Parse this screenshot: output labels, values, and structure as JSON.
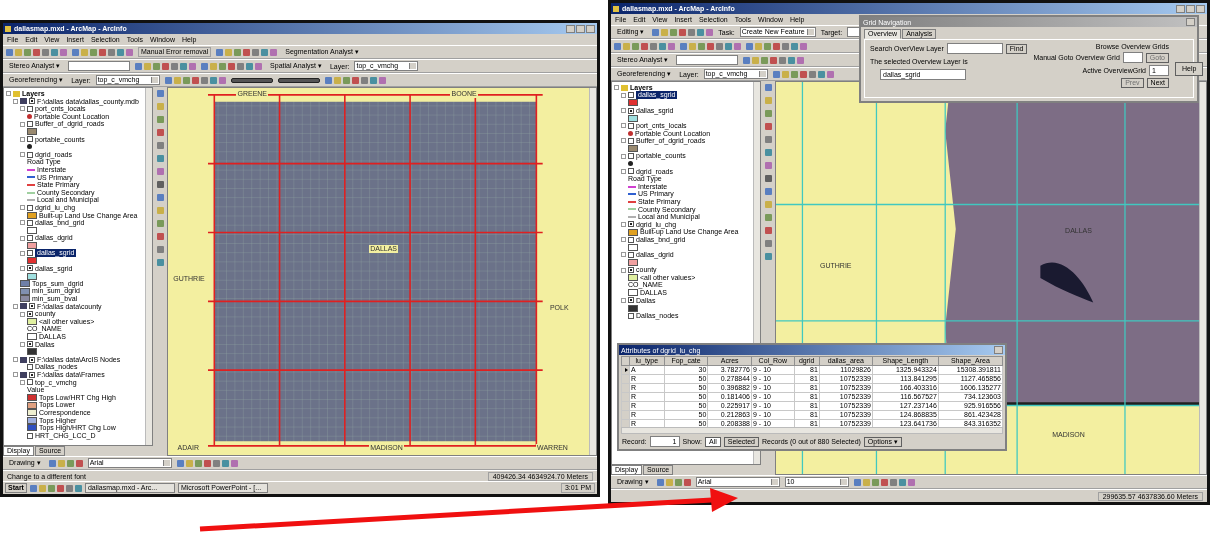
{
  "windows": [
    {
      "title": "dallasmap.mxd - ArcMap - ArcInfo",
      "menu": [
        "File",
        "Edit",
        "View",
        "Insert",
        "Selection",
        "Tools",
        "Window",
        "Help"
      ],
      "toolbars": [
        [
          {
            "kind": "icons"
          },
          {
            "kind": "icons"
          },
          {
            "kind": "button",
            "text": "Manual Error removal"
          },
          {
            "kind": "icons"
          },
          {
            "kind": "dropdown",
            "text": "Segmentation Analyst ▾"
          }
        ],
        [
          {
            "kind": "dropdown",
            "text": "Stereo Analyst ▾"
          },
          {
            "kind": "field"
          },
          {
            "kind": "icons"
          },
          {
            "kind": "icons"
          },
          {
            "kind": "dropdown",
            "text": "Spatial Analyst ▾"
          },
          {
            "kind": "label",
            "text": "Layer:"
          },
          {
            "kind": "combo",
            "text": "top_c_vmchg"
          }
        ],
        [
          {
            "kind": "dropdown",
            "text": "Georeferencing ▾"
          },
          {
            "kind": "label",
            "text": "Layer:"
          },
          {
            "kind": "combo",
            "text": "top_c_vmchg"
          },
          {
            "kind": "icons"
          },
          {
            "kind": "track"
          },
          {
            "kind": "track"
          },
          {
            "kind": "icons"
          }
        ]
      ],
      "toc": {
        "kind": "root",
        "label": "Layers",
        "children": [
          {
            "kind": "group",
            "label": "F:\\dallas data\\dallas_county.mdb",
            "checked": true,
            "selected": false,
            "children": [
              {
                "kind": "layer",
                "label": "port_cnts_locals",
                "checked": false,
                "selected": false,
                "children": [
                  {
                    "kind": "point",
                    "label": "Portable Count Location",
                    "color": "#c03030"
                  }
                ]
              },
              {
                "kind": "layer",
                "label": "Buffer_of_dgrid_roads",
                "checked": false,
                "selected": false,
                "children": [
                  {
                    "kind": "legend",
                    "color": "#9a8a70"
                  }
                ]
              },
              {
                "kind": "layer",
                "label": "portable_counts",
                "checked": false,
                "selected": false,
                "children": [
                  {
                    "kind": "point",
                    "color": "#222222"
                  }
                ]
              },
              {
                "kind": "layer",
                "label": "dgrid_roads",
                "checked": false,
                "selected": false,
                "children": [
                  {
                    "kind": "text",
                    "label": "Road Type"
                  },
                  {
                    "kind": "line",
                    "label": "Interstate",
                    "color": "#d040d0"
                  },
                  {
                    "kind": "line",
                    "label": "US Primary",
                    "color": "#3060d0"
                  },
                  {
                    "kind": "line",
                    "label": "State Primary",
                    "color": "#e04040"
                  },
                  {
                    "kind": "line",
                    "label": "County Secondary",
                    "color": "#a0d0a0"
                  },
                  {
                    "kind": "line",
                    "label": "Local and Municipal",
                    "color": "#b0b0b0"
                  }
                ]
              },
              {
                "kind": "layer",
                "label": "dgrid_lu_chg",
                "checked": false,
                "selected": false,
                "children": [
                  {
                    "kind": "legend",
                    "label": "Built-up Land Use Change Area",
                    "color": "#e0a020"
                  }
                ]
              },
              {
                "kind": "layer",
                "label": "dallas_bnd_grid",
                "checked": false,
                "selected": false,
                "children": [
                  {
                    "kind": "legend",
                    "color": "#ffffff"
                  }
                ]
              },
              {
                "kind": "layer",
                "label": "dallas_dgrid",
                "checked": false,
                "selected": false,
                "children": [
                  {
                    "kind": "legend",
                    "color": "#f0a0a0"
                  }
                ]
              },
              {
                "kind": "layer",
                "label": "dallas_sgrid",
                "checked": false,
                "selected": true,
                "children": [
                  {
                    "kind": "legend",
                    "color": "#e03030"
                  }
                ]
              },
              {
                "kind": "layer",
                "label": "dallas_sgrid",
                "checked": true,
                "selected": false,
                "children": [
                  {
                    "kind": "legend",
                    "color": "#a0e0e0"
                  }
                ]
              },
              {
                "kind": "legend",
                "label": "Tops_sum_dgrid",
                "color": "#7080a8"
              },
              {
                "kind": "legend",
                "label": "min_sum_dgrid",
                "color": "#8090b0"
              },
              {
                "kind": "legend",
                "label": "min_sum_bval",
                "color": "#8a8aa0"
              }
            ]
          },
          {
            "kind": "group",
            "label": "F:\\dallas data\\county",
            "checked": true,
            "selected": false,
            "children": [
              {
                "kind": "layer",
                "label": "county",
                "checked": true,
                "selected": false,
                "children": [
                  {
                    "kind": "legend",
                    "label": "<all other values>",
                    "color": "#e0f0a0"
                  },
                  {
                    "kind": "text",
                    "label": "CO_NAME"
                  },
                  {
                    "kind": "legend",
                    "label": "DALLAS",
                    "color": "#ffffff"
                  }
                ]
              },
              {
                "kind": "layer",
                "label": "Dallas",
                "checked": true,
                "selected": false,
                "children": [
                  {
                    "kind": "legend",
                    "color": "#333333"
                  }
                ]
              }
            ]
          },
          {
            "kind": "group",
            "label": "F:\\dallas data\\ArcIS Nodes",
            "checked": true,
            "selected": false,
            "children": [
              {
                "kind": "layer",
                "label": "Dallas_nodes",
                "checked": false,
                "selected": false
              }
            ]
          },
          {
            "kind": "group",
            "label": "F:\\dallas data\\Frames",
            "checked": true,
            "selected": false,
            "children": [
              {
                "kind": "layer",
                "label": "top_c_vmchg",
                "checked": false,
                "selected": false,
                "children": [
                  {
                    "kind": "text",
                    "label": "Value"
                  },
                  {
                    "kind": "legend",
                    "label": "Tops Low/HRT Chg High",
                    "color": "#d03030"
                  },
                  {
                    "kind": "legend",
                    "label": "Tops Lower",
                    "color": "#e0a080"
                  },
                  {
                    "kind": "legend",
                    "label": "Correspondence",
                    "color": "#f0f0d0"
                  },
                  {
                    "kind": "legend",
                    "label": "Tops Higher",
                    "color": "#a0b0e0"
                  },
                  {
                    "kind": "legend",
                    "label": "Tops High/HRT Chg Low",
                    "color": "#3050c0"
                  }
                ]
              },
              {
                "kind": "layer",
                "label": "HRT_CHG_LCC_D",
                "checked": false,
                "selected": false
              }
            ]
          }
        ]
      },
      "toc_tabs": [
        {
          "label": "Display",
          "selected": true
        },
        {
          "label": "Source",
          "selected": false
        }
      ],
      "map": {
        "kind": "grid-overview",
        "labels": [
          {
            "text": "GREENE"
          },
          {
            "text": "BOONE"
          },
          {
            "text": "GUTHRIE"
          },
          {
            "text": "DALLAS"
          },
          {
            "text": "POLK"
          },
          {
            "text": "ADAIR"
          },
          {
            "text": "MADISON"
          },
          {
            "text": "WARREN"
          }
        ]
      },
      "drawing_toolbar": {
        "label": "Drawing ▾",
        "font": "Arial"
      },
      "status": {
        "message": "Change to a different font",
        "coordinates": "409426.34  4634924.70 Meters"
      },
      "taskbar": {
        "start": "Start",
        "tasks": [
          "dallasmap.mxd - Arc...",
          "Microsoft PowerPoint - [..."
        ],
        "clock": "3:01 PM"
      }
    },
    {
      "title": "dallasmap.mxd - ArcMap - ArcInfo",
      "menu": [
        "File",
        "Edit",
        "View",
        "Insert",
        "Selection",
        "Tools",
        "Window",
        "Help"
      ],
      "toolbars": [
        [
          {
            "kind": "dropdown",
            "text": "Editing ▾"
          },
          {
            "kind": "icons"
          },
          {
            "kind": "label",
            "text": "Task:"
          },
          {
            "kind": "combo",
            "text": "Create New Feature"
          },
          {
            "kind": "label",
            "text": "Target:"
          },
          {
            "kind": "field"
          }
        ],
        [
          {
            "kind": "icons"
          },
          {
            "kind": "icons"
          },
          {
            "kind": "icons"
          }
        ],
        [
          {
            "kind": "dropdown",
            "text": "Stereo Analyst ▾"
          },
          {
            "kind": "field"
          },
          {
            "kind": "icons"
          }
        ],
        [
          {
            "kind": "dropdown",
            "text": "Georeferencing ▾"
          },
          {
            "kind": "label",
            "text": "Layer:"
          },
          {
            "kind": "combo",
            "text": "top_c_vmchg"
          },
          {
            "kind": "icons"
          }
        ]
      ],
      "toc": {
        "kind": "root",
        "label": "Layers",
        "children": [
          {
            "kind": "layer",
            "label": "dallas_sgrid",
            "checked": false,
            "selected": true,
            "children": [
              {
                "kind": "legend",
                "color": "#e03030"
              }
            ]
          },
          {
            "kind": "layer",
            "label": "dallas_sgrid",
            "checked": true,
            "selected": false,
            "children": [
              {
                "kind": "legend",
                "color": "#a0e0e0"
              }
            ]
          },
          {
            "kind": "layer",
            "label": "port_cnts_locals",
            "checked": false,
            "selected": false,
            "children": [
              {
                "kind": "point",
                "label": "Portable Count Location",
                "color": "#c03030"
              }
            ]
          },
          {
            "kind": "layer",
            "label": "Buffer_of_dgrid_roads",
            "checked": false,
            "selected": false,
            "children": [
              {
                "kind": "legend",
                "color": "#9a8a70"
              }
            ]
          },
          {
            "kind": "layer",
            "label": "portable_counts",
            "checked": false,
            "selected": false,
            "children": [
              {
                "kind": "point",
                "color": "#222222"
              }
            ]
          },
          {
            "kind": "layer",
            "label": "dgrid_roads",
            "checked": false,
            "selected": false,
            "children": [
              {
                "kind": "text",
                "label": "Road Type"
              },
              {
                "kind": "line",
                "label": "Interstate",
                "color": "#d040d0"
              },
              {
                "kind": "line",
                "label": "US Primary",
                "color": "#3060d0"
              },
              {
                "kind": "line",
                "label": "State Primary",
                "color": "#e04040"
              },
              {
                "kind": "line",
                "label": "County Secondary",
                "color": "#a0d0a0"
              },
              {
                "kind": "line",
                "label": "Local and Municipal",
                "color": "#b0b0b0"
              }
            ]
          },
          {
            "kind": "layer",
            "label": "dgrid_lu_chg",
            "checked": true,
            "selected": false,
            "children": [
              {
                "kind": "legend",
                "label": "Built-up Land Use Change Area",
                "color": "#e0a020"
              }
            ]
          },
          {
            "kind": "layer",
            "label": "dallas_bnd_grid",
            "checked": false,
            "selected": false,
            "children": [
              {
                "kind": "legend",
                "color": "#ffffff"
              }
            ]
          },
          {
            "kind": "layer",
            "label": "dallas_dgrid",
            "checked": false,
            "selected": false,
            "children": [
              {
                "kind": "legend",
                "color": "#f0a0a0"
              }
            ]
          },
          {
            "kind": "layer",
            "label": "county",
            "checked": true,
            "selected": false,
            "children": [
              {
                "kind": "legend",
                "label": "<all other values>",
                "color": "#e0f0a0"
              },
              {
                "kind": "text",
                "label": "CO_NAME"
              },
              {
                "kind": "legend",
                "label": "DALLAS",
                "color": "#ffffff"
              }
            ]
          },
          {
            "kind": "layer",
            "label": "Dallas",
            "checked": true,
            "selected": false,
            "children": [
              {
                "kind": "legend",
                "color": "#333333"
              }
            ]
          },
          {
            "kind": "layer",
            "label": "Dallas_nodes",
            "checked": false,
            "selected": false
          }
        ]
      },
      "toc_tabs": [
        {
          "label": "Display",
          "selected": true
        },
        {
          "label": "Source",
          "selected": false
        }
      ],
      "map": {
        "kind": "zoomed-grid",
        "labels": [
          {
            "text": "GUTHRIE"
          },
          {
            "text": "DALLAS"
          },
          {
            "text": "MADISON"
          }
        ]
      },
      "drawing_toolbar": {
        "label": "Drawing ▾",
        "font": "Arial",
        "size": "10"
      },
      "status": {
        "coordinates": "299635.57  4637836.60 Meters"
      },
      "dialog": {
        "title": "Grid Navigation",
        "tabs": [
          {
            "label": "Overview",
            "selected": true
          },
          {
            "label": "Analysis",
            "selected": false
          }
        ],
        "search_label": "Search OverView Layer",
        "find": "Find",
        "browse_label": "Browse Overview Grids",
        "goto_label": "Manual Goto Overview Grid",
        "goto": "Goto",
        "active_label": "Active OverviewGrid",
        "active_value": "1",
        "help": "Help",
        "selected_label": "The selected Overview Layer is",
        "selected_value": "dallas_sgrid",
        "prev": "Prev",
        "next": "Next"
      },
      "attribute_table": {
        "title": "Attributes of dgrid_lu_chg",
        "columns": [
          "lu_type",
          "Fop_cate",
          "Acres",
          "Col_Row",
          "dgrid",
          "dallas_area",
          "Shape_Length",
          "Shape_Area"
        ],
        "rows": [
          [
            "A",
            "30",
            "3.782776",
            "9 - 10",
            "81",
            "11029826",
            "1325.943324",
            "15308.391811"
          ],
          [
            "R",
            "50",
            "0.278844",
            "9 - 10",
            "81",
            "10752339",
            "113.841295",
            "1127.465856"
          ],
          [
            "R",
            "50",
            "0.396882",
            "9 - 10",
            "81",
            "10752339",
            "166.403316",
            "1606.135277"
          ],
          [
            "R",
            "50",
            "0.181406",
            "9 - 10",
            "81",
            "10752339",
            "116.567527",
            "734.123603"
          ],
          [
            "R",
            "50",
            "0.225917",
            "9 - 10",
            "81",
            "10752339",
            "127.237146",
            "925.916556"
          ],
          [
            "R",
            "50",
            "0.212863",
            "9 - 10",
            "81",
            "10752339",
            "124.868835",
            "861.423428"
          ],
          [
            "R",
            "50",
            "0.208388",
            "9 - 10",
            "81",
            "10752339",
            "123.641736",
            "843.316352"
          ]
        ],
        "record_label": "Record:",
        "record": "1",
        "show_label": "Show:",
        "show_options": [
          {
            "label": "All",
            "selected": true
          },
          {
            "label": "Selected",
            "selected": false
          }
        ],
        "summary": "Records (0 out of 880 Selected)",
        "options": "Options ▾"
      }
    }
  ]
}
